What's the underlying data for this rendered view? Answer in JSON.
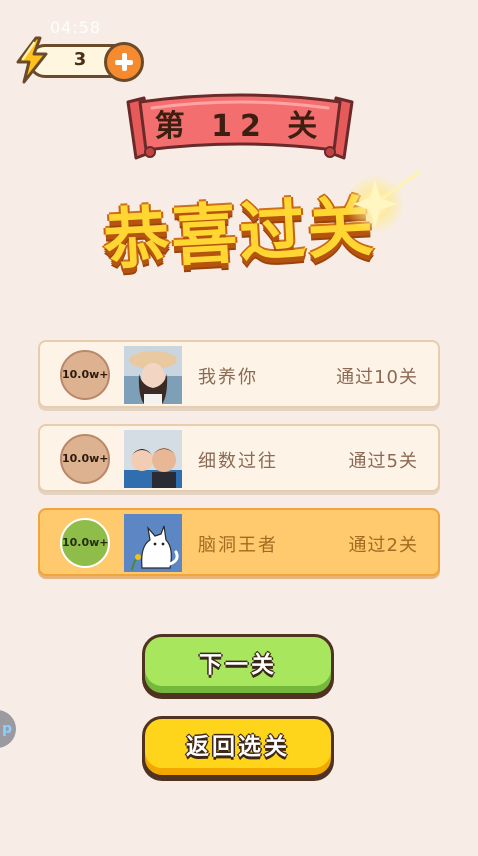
{
  "status": {
    "time": "04:58"
  },
  "energy": {
    "count": "3",
    "icon": "lightning-icon",
    "add_icon": "plus-icon"
  },
  "level": {
    "label": "第 12 关"
  },
  "title": "恭喜过关",
  "ranking": [
    {
      "badge": "10.0w+",
      "name": "我养你",
      "score": "通过10关",
      "is_self": false
    },
    {
      "badge": "10.0w+",
      "name": "细数过往",
      "score": "通过5关",
      "is_self": false
    },
    {
      "badge": "10.0w+",
      "name": "脑洞王者",
      "score": "通过2关",
      "is_self": true
    }
  ],
  "buttons": {
    "next": "下一关",
    "back": "返回选关"
  },
  "side_float": {
    "label": "p"
  },
  "colors": {
    "background": "#f7ede6",
    "title": "#ffd632",
    "banner": "#f26b6b",
    "next_button": "#a7e65d",
    "back_button": "#ffd51c",
    "self_card": "#ffc96e"
  }
}
